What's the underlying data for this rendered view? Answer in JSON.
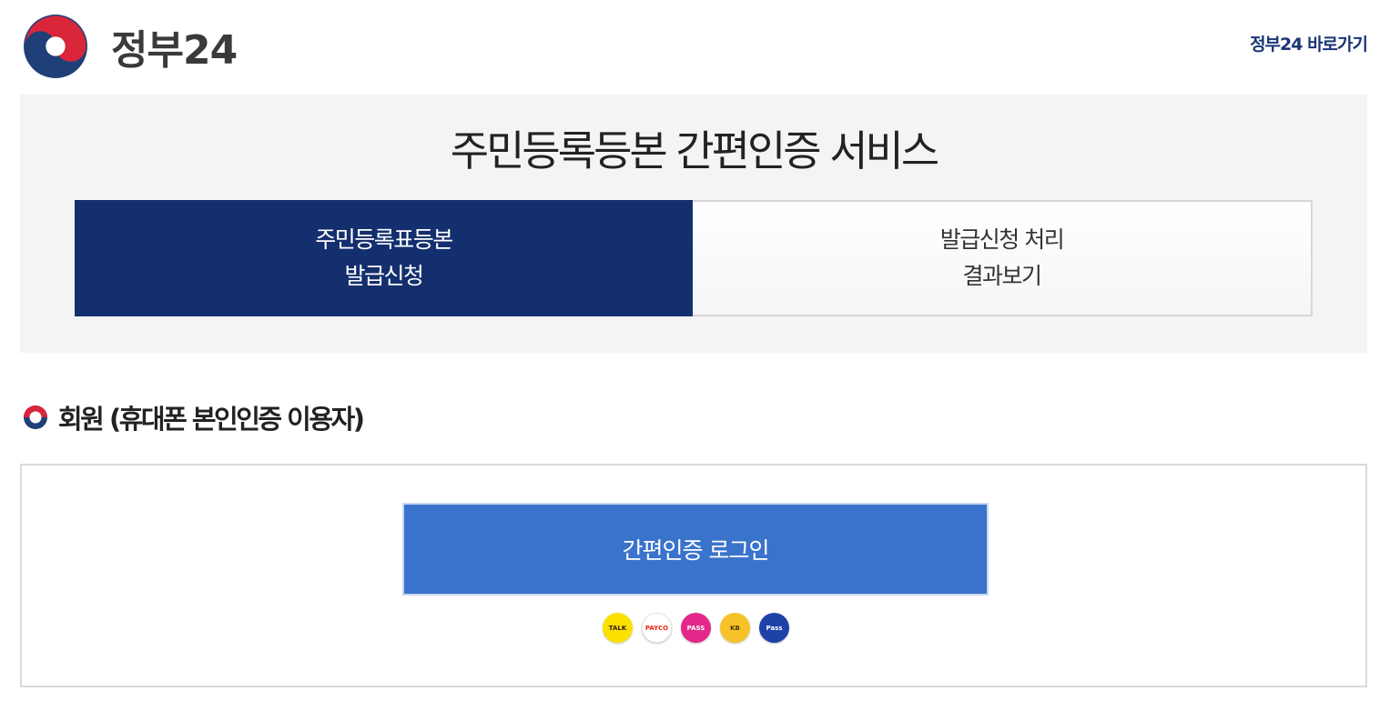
{
  "header": {
    "logo_text": "정부24",
    "top_link": "정부24 바로가기"
  },
  "hero": {
    "title": "주민등록등본 간편인증 서비스",
    "steps": [
      {
        "line1": "주민등록표등본",
        "line2": "발급신청",
        "active": true
      },
      {
        "line1": "발급신청 처리",
        "line2": "결과보기",
        "active": false
      }
    ]
  },
  "section": {
    "title": "회원 (휴대폰 본인인증 이용자)"
  },
  "login": {
    "button_label": "간편인증 로그인",
    "providers": [
      {
        "icon": "kakao-talk-icon",
        "mark": "TALK"
      },
      {
        "icon": "payco-icon",
        "mark": "PAYCO"
      },
      {
        "icon": "pass-icon",
        "mark": "PASS"
      },
      {
        "icon": "kb-icon",
        "mark": "KB"
      },
      {
        "icon": "samsung-pass-icon",
        "mark": "Pass"
      }
    ]
  },
  "colors": {
    "brand_navy": "#142f6e",
    "login_blue": "#3a73cc",
    "hero_bg": "#f4f4f4"
  }
}
